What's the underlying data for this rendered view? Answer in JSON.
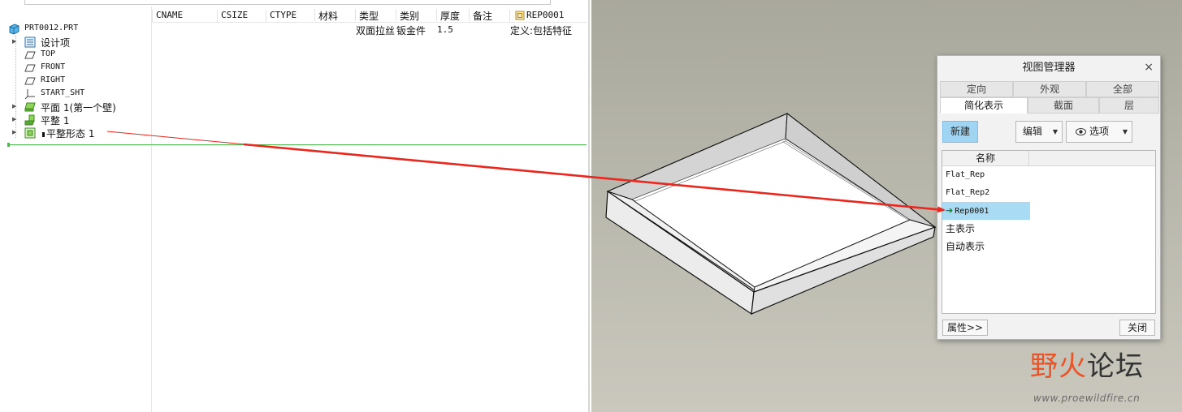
{
  "tree": {
    "columns": [
      "CNAME",
      "CSIZE",
      "CTYPE",
      "材料",
      "类型",
      "类别",
      "厚度",
      "备注",
      "REP0001"
    ],
    "items": [
      {
        "label": "PRT0012.PRT",
        "icon": "part-icon"
      },
      {
        "label": "设计项",
        "icon": "design-items-icon"
      },
      {
        "label": "TOP",
        "icon": "datum-plane-icon"
      },
      {
        "label": "FRONT",
        "icon": "datum-plane-icon"
      },
      {
        "label": "RIGHT",
        "icon": "datum-plane-icon"
      },
      {
        "label": "START_SHT",
        "icon": "coordinate-system-icon"
      },
      {
        "label": "平面 1(第一个壁)",
        "icon": "planar-wall-icon"
      },
      {
        "label": "平整 1",
        "icon": "flat-wall-icon"
      },
      {
        "label": "平整形态 1",
        "icon": "flat-pattern-icon"
      }
    ],
    "row_values": {
      "类型": "双面拉丝",
      "类别": "钣金件",
      "厚度": "1.5",
      "REP0001": "定义:包括特征"
    }
  },
  "dialog": {
    "title": "视图管理器",
    "close_glyph": "×",
    "tabs_row1": [
      "定向",
      "外观",
      "全部"
    ],
    "tabs_row2": [
      "简化表示",
      "截面",
      "层"
    ],
    "active_tab": "简化表示",
    "new_label": "新建",
    "edit_label": "编辑",
    "options_label": "选项",
    "caret_glyph": "▼",
    "list_header": "名称",
    "reps": [
      "Flat_Rep",
      "Flat_Rep2",
      "Rep0001",
      "主表示",
      "自动表示"
    ],
    "active_rep": "Rep0001",
    "active_marker": "➔",
    "properties_label": "属性>>",
    "close_label": "关闭",
    "accent_color": "#9fd4f2",
    "selection_color": "#a9dcf4"
  },
  "watermark": {
    "logo_left": "野火",
    "logo_right": "论坛",
    "url": "www.proewildfire.cn"
  },
  "colors": {
    "callout_arrow": "#e8281e",
    "insert_line": "#4bb84b",
    "viewport_bg": "#b8b7ac"
  }
}
